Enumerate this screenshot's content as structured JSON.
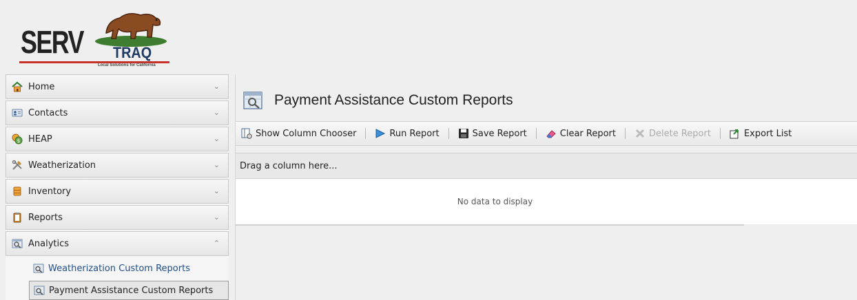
{
  "brand": {
    "logo_serv": "SERV",
    "logo_traq": "TRAQ",
    "tagline": "Local Solutions for California",
    "colors": {
      "red": "#c8312b",
      "navy": "#1f3a63"
    }
  },
  "sidebar": {
    "items": [
      {
        "label": "Home",
        "icon": "home-icon",
        "chevron": "⌄"
      },
      {
        "label": "Contacts",
        "icon": "contacts-card-icon",
        "chevron": "⌄"
      },
      {
        "label": "HEAP",
        "icon": "money-icon",
        "chevron": "⌄"
      },
      {
        "label": "Weatherization",
        "icon": "tools-icon",
        "chevron": "⌄"
      },
      {
        "label": "Inventory",
        "icon": "inventory-icon",
        "chevron": "⌄"
      },
      {
        "label": "Reports",
        "icon": "clipboard-icon",
        "chevron": "⌄"
      },
      {
        "label": "Analytics",
        "icon": "analytics-icon",
        "chevron": "⌃"
      }
    ],
    "analytics_children": [
      {
        "label": "Weatherization Custom Reports",
        "icon": "custom-report-icon"
      },
      {
        "label": "Payment Assistance Custom Reports",
        "icon": "custom-report-icon",
        "selected": true
      }
    ]
  },
  "main": {
    "title": "Payment Assistance Custom Reports",
    "title_icon": "custom-report-icon",
    "toolbar": {
      "show_column_chooser": "Show Column Chooser",
      "run_report": "Run Report",
      "save_report": "Save Report",
      "clear_report": "Clear Report",
      "delete_report": "Delete Report",
      "export_list": "Export List"
    },
    "group_panel_text": "Drag a column here...",
    "empty_text": "No data to display"
  }
}
